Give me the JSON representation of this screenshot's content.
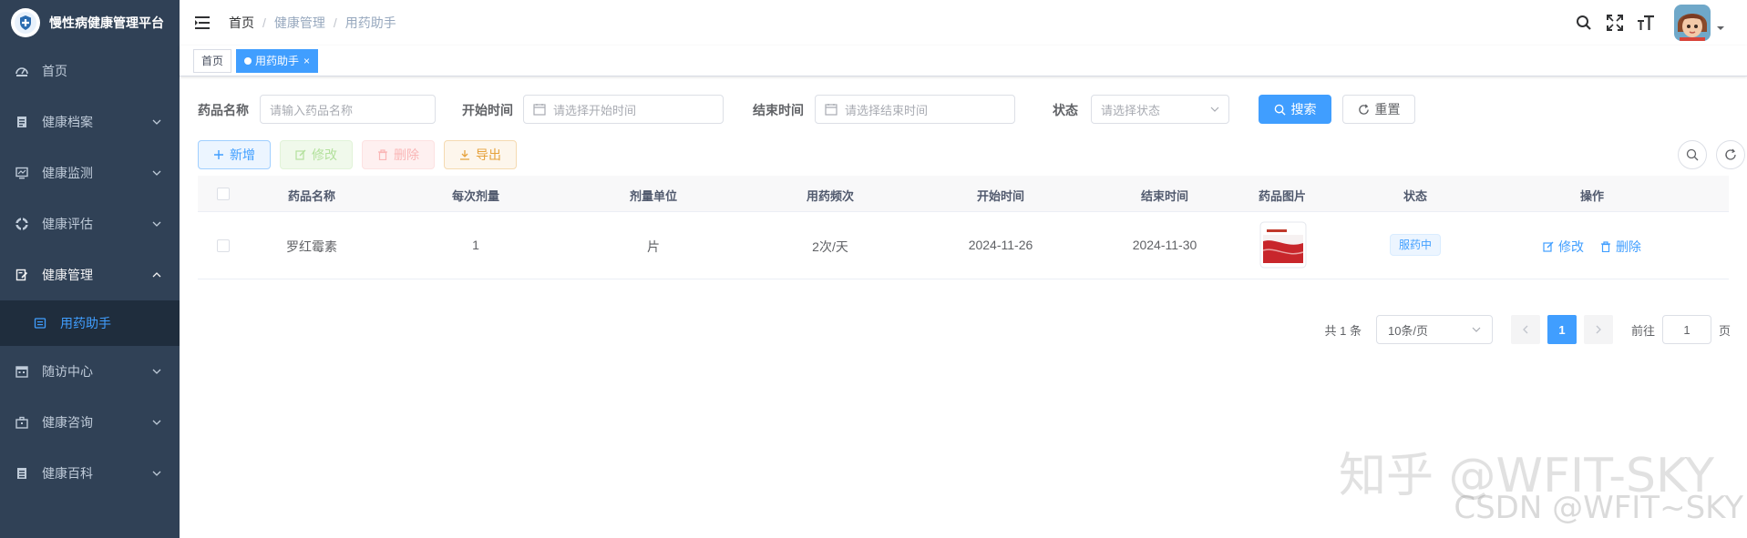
{
  "app": {
    "title": "慢性病健康管理平台"
  },
  "sidebar": {
    "items": [
      {
        "label": "首页",
        "icon": "dashboard-icon"
      },
      {
        "label": "健康档案",
        "icon": "document-icon"
      },
      {
        "label": "健康监测",
        "icon": "monitor-icon"
      },
      {
        "label": "健康评估",
        "icon": "assess-icon"
      },
      {
        "label": "健康管理",
        "icon": "edit-doc-icon"
      },
      {
        "label": "随访中心",
        "icon": "calendar-icon"
      },
      {
        "label": "健康咨询",
        "icon": "briefcase-icon"
      },
      {
        "label": "健康百科",
        "icon": "book-icon"
      }
    ],
    "active_sub": {
      "label": "用药助手",
      "icon": "pill-list-icon"
    }
  },
  "navbar": {
    "breadcrumb": [
      "首页",
      "健康管理",
      "用药助手"
    ],
    "separator": "/"
  },
  "tags": {
    "items": [
      {
        "label": "首页"
      },
      {
        "label": "用药助手",
        "close": "×"
      }
    ]
  },
  "search": {
    "drug_label": "药品名称",
    "drug_placeholder": "请输入药品名称",
    "start_label": "开始时间",
    "start_placeholder": "请选择开始时间",
    "end_label": "结束时间",
    "end_placeholder": "请选择结束时间",
    "status_label": "状态",
    "status_placeholder": "请选择状态",
    "search_button": "搜索",
    "reset_button": "重置"
  },
  "toolbar": {
    "add": "新增",
    "edit": "修改",
    "delete": "删除",
    "export": "导出"
  },
  "table": {
    "columns": [
      "药品名称",
      "每次剂量",
      "剂量单位",
      "用药频次",
      "开始时间",
      "结束时间",
      "药品图片",
      "状态",
      "操作"
    ],
    "rows": [
      {
        "name": "罗红霉素",
        "dose": "1",
        "unit": "片",
        "frequency": "2次/天",
        "start": "2024-11-26",
        "end": "2024-11-30",
        "status": "服药中",
        "edit": "修改",
        "delete": "删除"
      }
    ]
  },
  "pagination": {
    "total": "共 1 条",
    "page_size": "10条/页",
    "current": "1",
    "goto_label": "前往",
    "goto_value": "1",
    "page_suffix": "页"
  },
  "watermark": {
    "line1": "知乎 @WFIT-SKY",
    "line2": "CSDN @WFIT~SKY"
  },
  "colors": {
    "sidebar_bg": "#304156",
    "submenu_bg": "#1f2d3d",
    "primary": "#409eff"
  }
}
